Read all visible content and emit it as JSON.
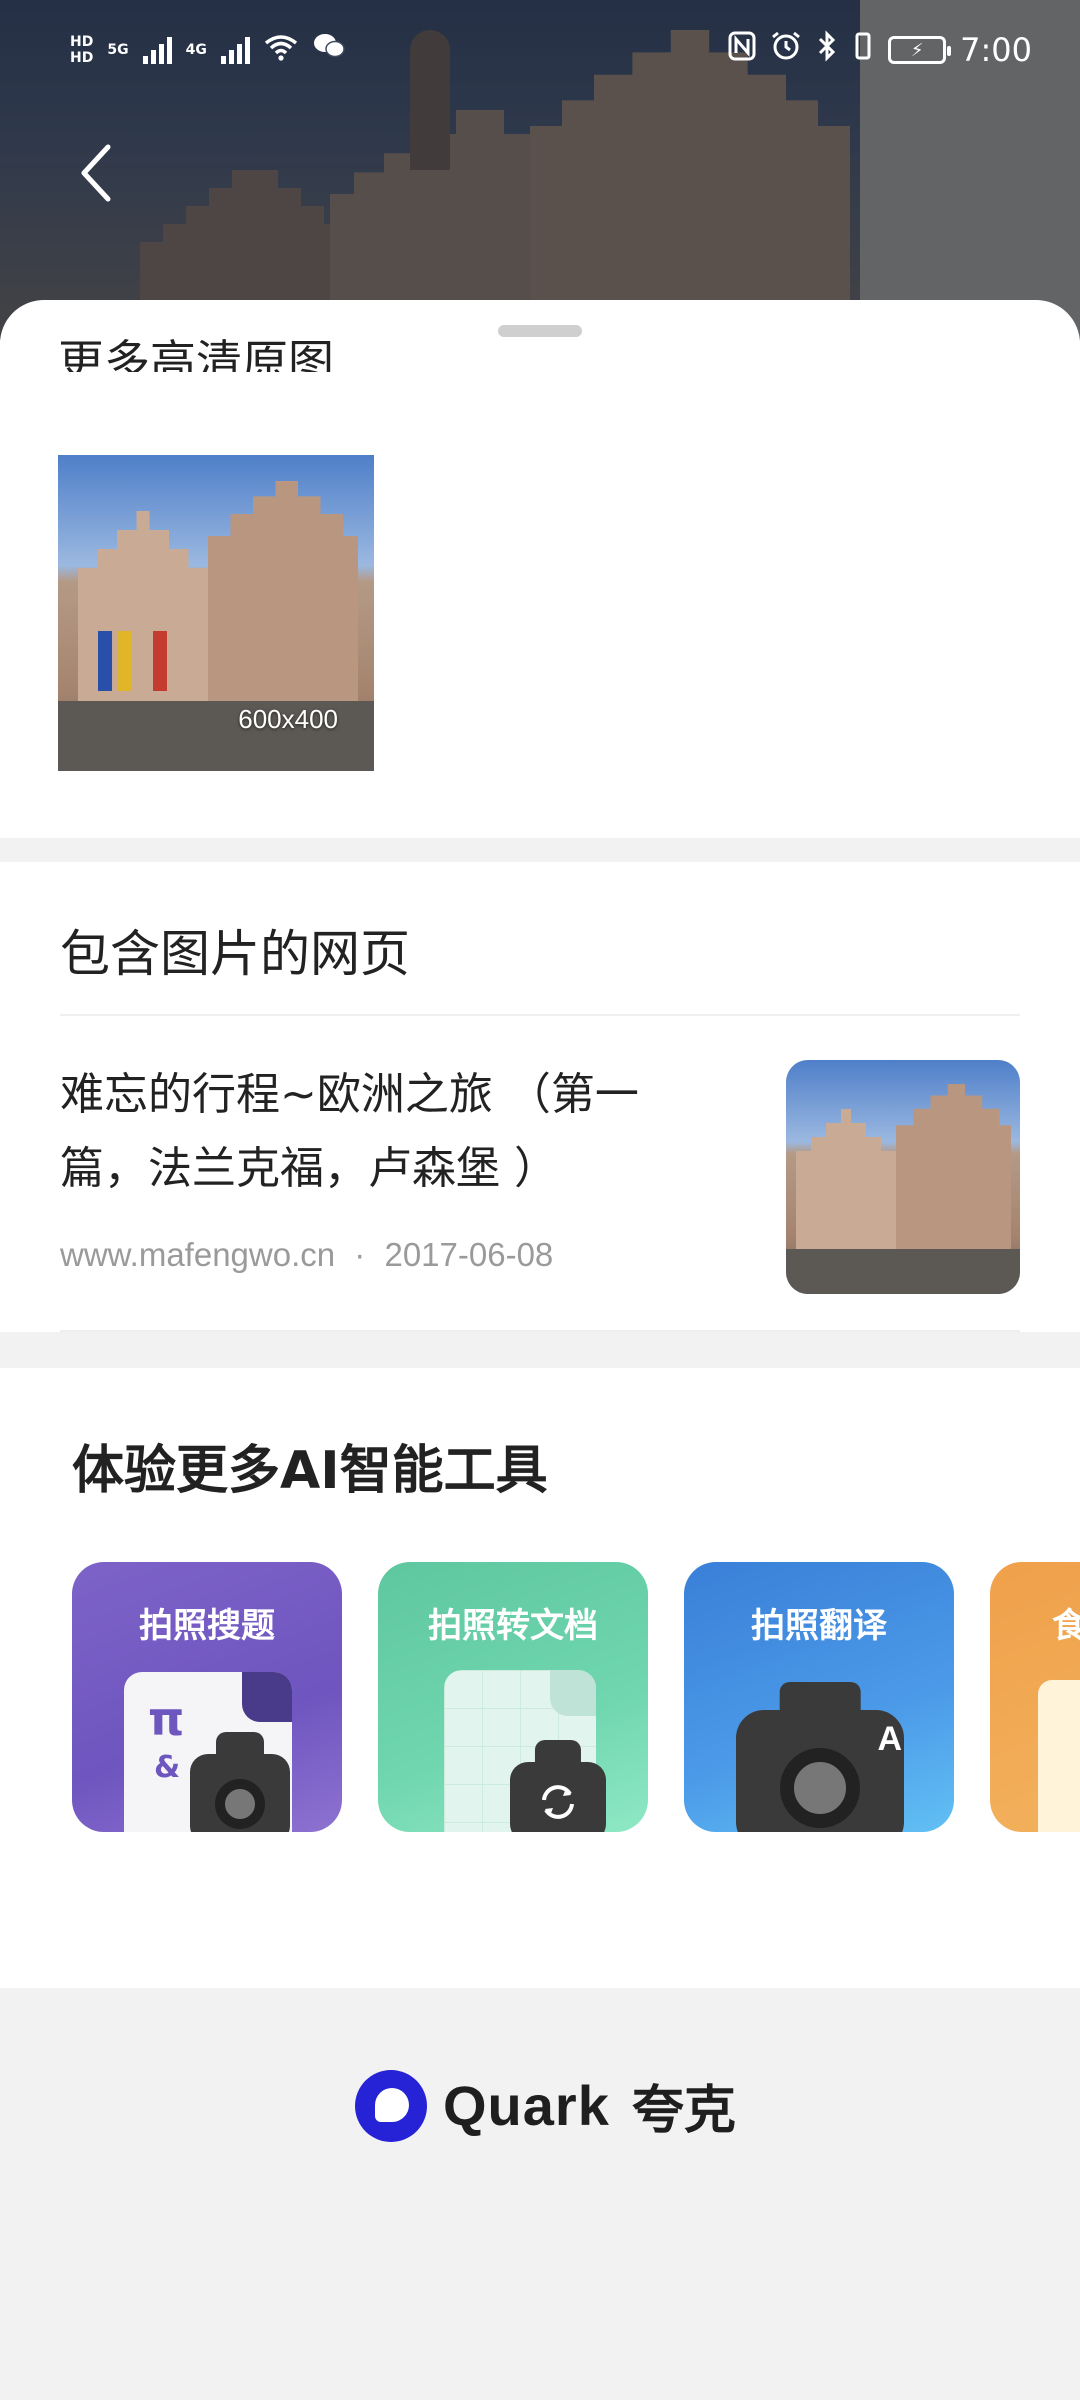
{
  "status_bar": {
    "left_badges": [
      "HD",
      "HD",
      "5G",
      "4G"
    ],
    "time": "7:00"
  },
  "header": {
    "back_icon": "chevron-left-icon"
  },
  "more_images": {
    "title": "更多高清原图",
    "items": [
      {
        "dimensions": "600x400"
      }
    ]
  },
  "webpages": {
    "title": "包含图片的网页",
    "results": [
      {
        "title": "难忘的行程~欧洲之旅 （第一篇，法兰克福，卢森堡 ）",
        "source": "www.mafengwo.cn",
        "separator": "·",
        "date": "2017-06-08"
      }
    ]
  },
  "ai_tools": {
    "title": "体验更多AI智能工具",
    "tools": [
      {
        "label": "拍照搜题",
        "pi": "π",
        "amp": "&"
      },
      {
        "label": "拍照转文档"
      },
      {
        "label": "拍照翻译",
        "badge": "A"
      },
      {
        "label": "食"
      }
    ]
  },
  "footer": {
    "brand_name": "Quark",
    "brand_cn": "夸克",
    "brand_color": "#2622d6"
  }
}
